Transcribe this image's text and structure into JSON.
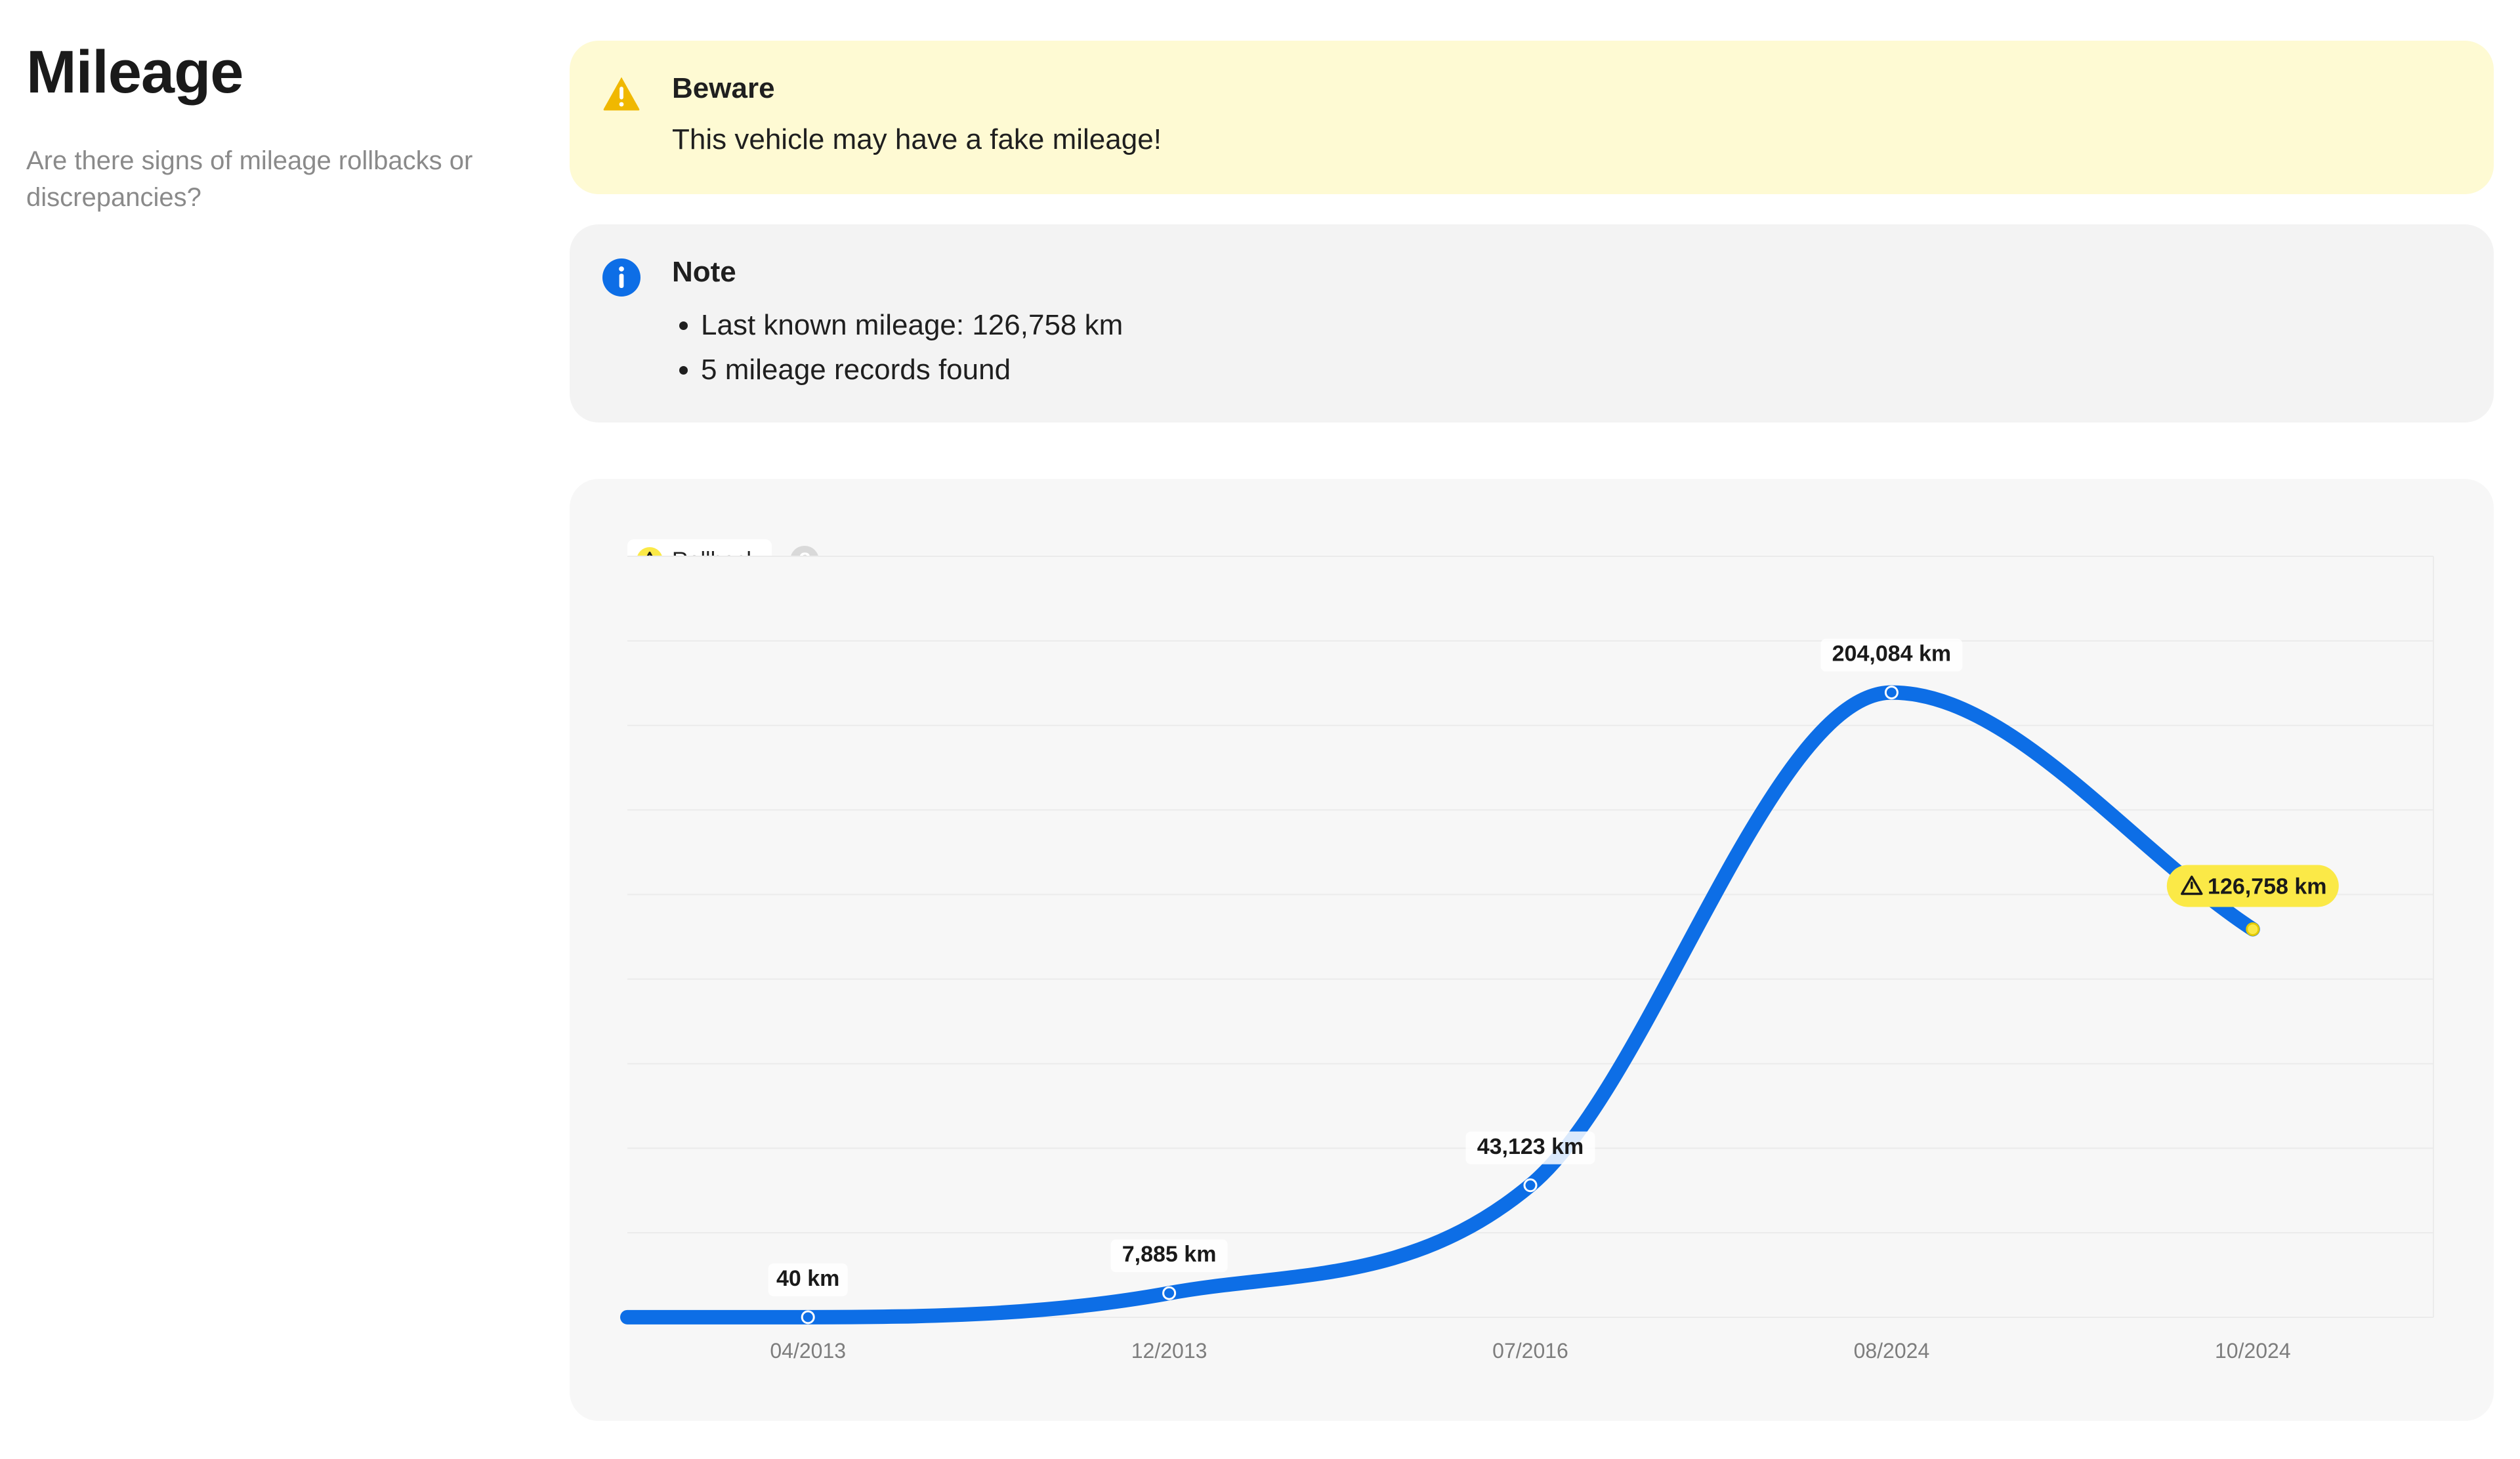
{
  "section": {
    "title": "Mileage",
    "subtitle": "Are there signs of mileage rollbacks or discrepancies?"
  },
  "warning": {
    "icon": "warning-triangle-icon",
    "color": "#f0b800",
    "background": "#fefad3",
    "title": "Beware",
    "text": "This vehicle may have a fake mileage!"
  },
  "note": {
    "icon": "info-icon",
    "color": "#0d6ee6",
    "title": "Note",
    "items": [
      "Last known mileage: 126,758 km",
      "5 mileage records found"
    ]
  },
  "legend": {
    "rollback_label": "Rollback",
    "rollback_color": "#fbe947",
    "help_symbol": "?"
  },
  "chart_data": {
    "type": "line",
    "categories": [
      "04/2013",
      "12/2013",
      "07/2016",
      "08/2024",
      "10/2024"
    ],
    "values": [
      40,
      7885,
      43123,
      204084,
      126758
    ],
    "data_labels": [
      "40 km",
      "7,885 km",
      "43,123 km",
      "204,084 km",
      "126,758 km"
    ],
    "rollback": [
      false,
      false,
      false,
      false,
      true
    ],
    "line_color": "#0d6ee6",
    "rollback_color": "#fbe947",
    "ylim": [
      0,
      225000
    ],
    "grid": true,
    "legend_position": "top-left"
  }
}
